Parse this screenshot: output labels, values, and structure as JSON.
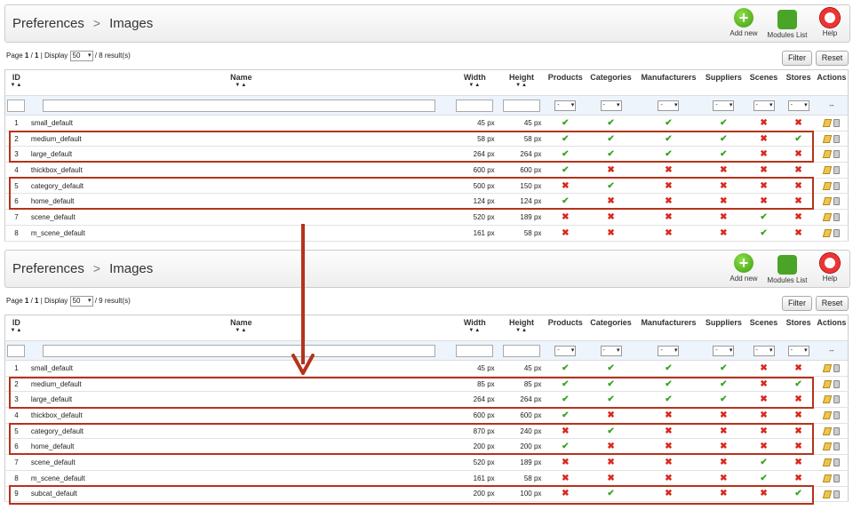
{
  "panels": [
    {
      "breadcrumb": {
        "section": "Preferences",
        "separator": ">",
        "page": "Images"
      },
      "toolbar": {
        "add_new": "Add new",
        "modules_list": "Modules List",
        "help": "Help"
      },
      "pager": {
        "page_label": "Page",
        "page": "1",
        "of": "1",
        "display_label": "Display",
        "display_value": "50",
        "results": "8 result(s)"
      },
      "buttons": {
        "filter": "Filter",
        "reset": "Reset"
      },
      "rows": [
        {
          "id": "1",
          "name": "small_default",
          "width": "45 px",
          "height": "45 px",
          "products": true,
          "categories": true,
          "manufacturers": true,
          "suppliers": true,
          "scenes": false,
          "stores": false
        },
        {
          "id": "2",
          "name": "medium_default",
          "width": "58 px",
          "height": "58 px",
          "products": true,
          "categories": true,
          "manufacturers": true,
          "suppliers": true,
          "scenes": false,
          "stores": true
        },
        {
          "id": "3",
          "name": "large_default",
          "width": "264 px",
          "height": "264 px",
          "products": true,
          "categories": true,
          "manufacturers": true,
          "suppliers": true,
          "scenes": false,
          "stores": false
        },
        {
          "id": "4",
          "name": "thickbox_default",
          "width": "600 px",
          "height": "600 px",
          "products": true,
          "categories": false,
          "manufacturers": false,
          "suppliers": false,
          "scenes": false,
          "stores": false
        },
        {
          "id": "5",
          "name": "category_default",
          "width": "500 px",
          "height": "150 px",
          "products": false,
          "categories": true,
          "manufacturers": false,
          "suppliers": false,
          "scenes": false,
          "stores": false
        },
        {
          "id": "6",
          "name": "home_default",
          "width": "124 px",
          "height": "124 px",
          "products": true,
          "categories": false,
          "manufacturers": false,
          "suppliers": false,
          "scenes": false,
          "stores": false
        },
        {
          "id": "7",
          "name": "scene_default",
          "width": "520 px",
          "height": "189 px",
          "products": false,
          "categories": false,
          "manufacturers": false,
          "suppliers": false,
          "scenes": true,
          "stores": false
        },
        {
          "id": "8",
          "name": "m_scene_default",
          "width": "161 px",
          "height": "58 px",
          "products": false,
          "categories": false,
          "manufacturers": false,
          "suppliers": false,
          "scenes": true,
          "stores": false
        }
      ]
    },
    {
      "breadcrumb": {
        "section": "Preferences",
        "separator": ">",
        "page": "Images"
      },
      "toolbar": {
        "add_new": "Add new",
        "modules_list": "Modules List",
        "help": "Help"
      },
      "pager": {
        "page_label": "Page",
        "page": "1",
        "of": "1",
        "display_label": "Display",
        "display_value": "50",
        "results": "9 result(s)"
      },
      "buttons": {
        "filter": "Filter",
        "reset": "Reset"
      },
      "rows": [
        {
          "id": "1",
          "name": "small_default",
          "width": "45 px",
          "height": "45 px",
          "products": true,
          "categories": true,
          "manufacturers": true,
          "suppliers": true,
          "scenes": false,
          "stores": false
        },
        {
          "id": "2",
          "name": "medium_default",
          "width": "85 px",
          "height": "85 px",
          "products": true,
          "categories": true,
          "manufacturers": true,
          "suppliers": true,
          "scenes": false,
          "stores": true
        },
        {
          "id": "3",
          "name": "large_default",
          "width": "264 px",
          "height": "264 px",
          "products": true,
          "categories": true,
          "manufacturers": true,
          "suppliers": true,
          "scenes": false,
          "stores": false
        },
        {
          "id": "4",
          "name": "thickbox_default",
          "width": "600 px",
          "height": "600 px",
          "products": true,
          "categories": false,
          "manufacturers": false,
          "suppliers": false,
          "scenes": false,
          "stores": false
        },
        {
          "id": "5",
          "name": "category_default",
          "width": "870 px",
          "height": "240 px",
          "products": false,
          "categories": true,
          "manufacturers": false,
          "suppliers": false,
          "scenes": false,
          "stores": false
        },
        {
          "id": "6",
          "name": "home_default",
          "width": "200 px",
          "height": "200 px",
          "products": true,
          "categories": false,
          "manufacturers": false,
          "suppliers": false,
          "scenes": false,
          "stores": false
        },
        {
          "id": "7",
          "name": "scene_default",
          "width": "520 px",
          "height": "189 px",
          "products": false,
          "categories": false,
          "manufacturers": false,
          "suppliers": false,
          "scenes": true,
          "stores": false
        },
        {
          "id": "8",
          "name": "m_scene_default",
          "width": "161 px",
          "height": "58 px",
          "products": false,
          "categories": false,
          "manufacturers": false,
          "suppliers": false,
          "scenes": true,
          "stores": false
        },
        {
          "id": "9",
          "name": "subcat_default",
          "width": "200 px",
          "height": "100 px",
          "products": false,
          "categories": true,
          "manufacturers": false,
          "suppliers": false,
          "scenes": false,
          "stores": true
        }
      ]
    }
  ],
  "columns": {
    "id": "ID",
    "name": "Name",
    "width": "Width",
    "height": "Height",
    "products": "Products",
    "categories": "Categories",
    "manufacturers": "Manufacturers",
    "suppliers": "Suppliers",
    "scenes": "Scenes",
    "stores": "Stores",
    "actions": "Actions"
  },
  "filter": {
    "yesno_placeholder": "-",
    "actions_placeholder": "--"
  },
  "icons": {
    "yes": "check-icon",
    "no": "cross-icon",
    "edit": "edit-icon",
    "delete": "trash-icon"
  },
  "colors": {
    "yes": "#3aa526",
    "no": "#d9281e",
    "highlight": "#b5331b",
    "filter_row": "#eef4fb"
  }
}
